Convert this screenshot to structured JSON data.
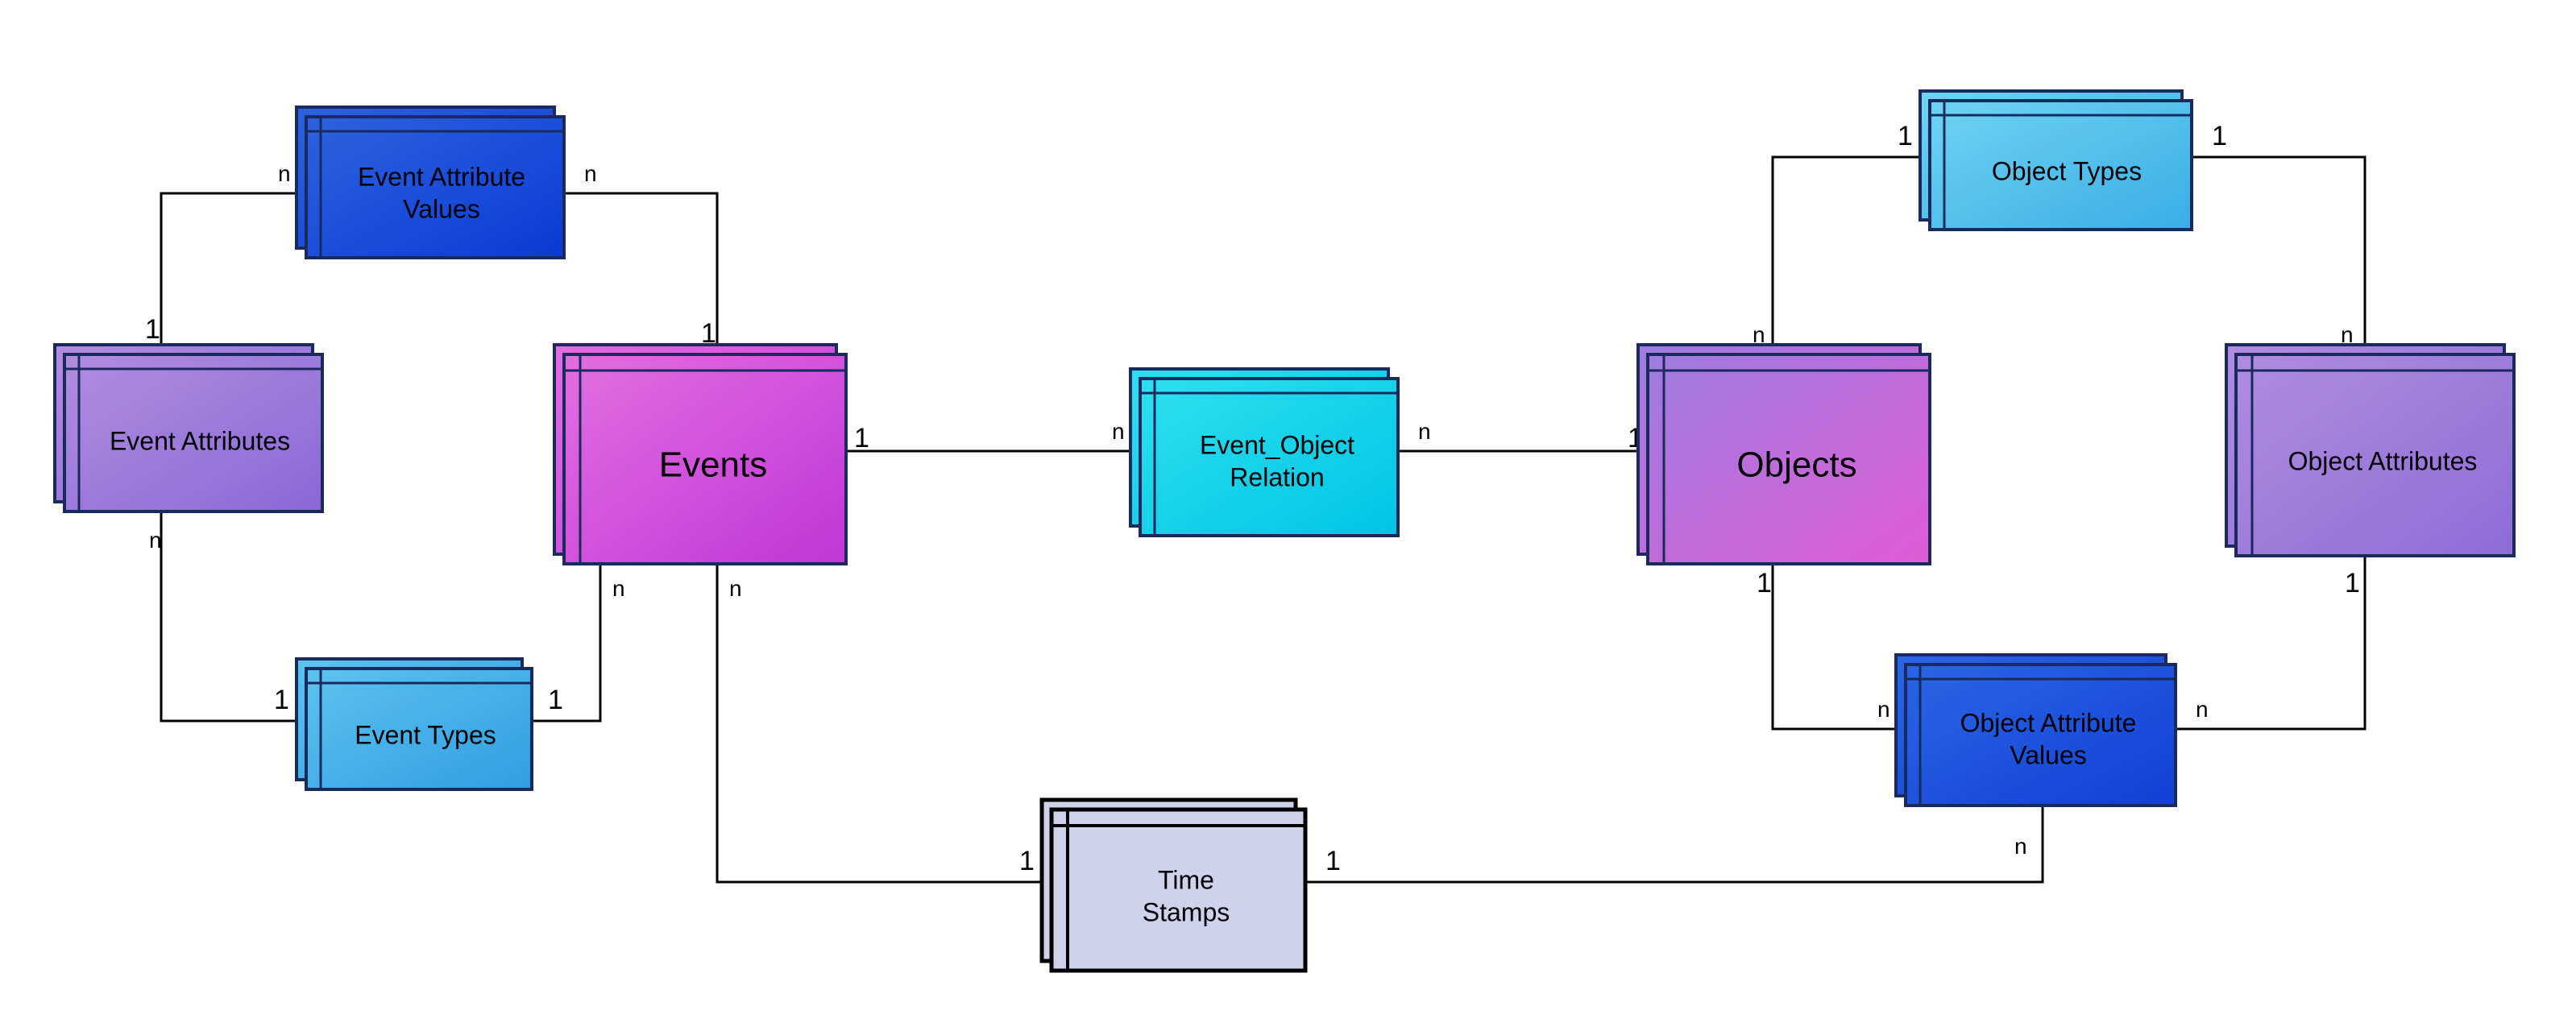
{
  "entities": {
    "eventAttributeValues": {
      "label1": "Event Attribute",
      "label2": "Values"
    },
    "eventAttributes": {
      "label": "Event Attributes"
    },
    "eventTypes": {
      "label": "Event Types"
    },
    "events": {
      "label": "Events"
    },
    "eventObjectRelation": {
      "label1": "Event_Object",
      "label2": "Relation"
    },
    "timeStamps": {
      "label1": "Time",
      "label2": "Stamps"
    },
    "objects": {
      "label": "Objects"
    },
    "objectTypes": {
      "label": "Object Types"
    },
    "objectAttributes": {
      "label": "Object Attributes"
    },
    "objectAttributeValues": {
      "label1": "Object Attribute",
      "label2": "Values"
    }
  },
  "card": {
    "one": "1",
    "n": "n"
  },
  "colors": {
    "strokeDark": "#1a2a5c",
    "eventAttrValGrad": [
      "#2d63e0",
      "#0a3bd4"
    ],
    "eventAttributesGrad": [
      "#b18de0",
      "#8a68d6"
    ],
    "eventTypesGrad": [
      "#5cc3f0",
      "#2f9ee0"
    ],
    "eventsGrad": [
      "#e06fe0",
      "#c335d8"
    ],
    "eventObjRelGrad": [
      "#2de0f0",
      "#00c4e4"
    ],
    "timeStampsFill": "#cfd2ec",
    "objectsGrad": [
      "#9d7de0",
      "#e05ad8"
    ],
    "objectTypesGrad": [
      "#6dd4f2",
      "#3aade6"
    ],
    "objectAttributesGrad": [
      "#b08ce0",
      "#8d6cd6"
    ],
    "objectAttrValGrad": [
      "#2a66e6",
      "#1040d4"
    ]
  }
}
